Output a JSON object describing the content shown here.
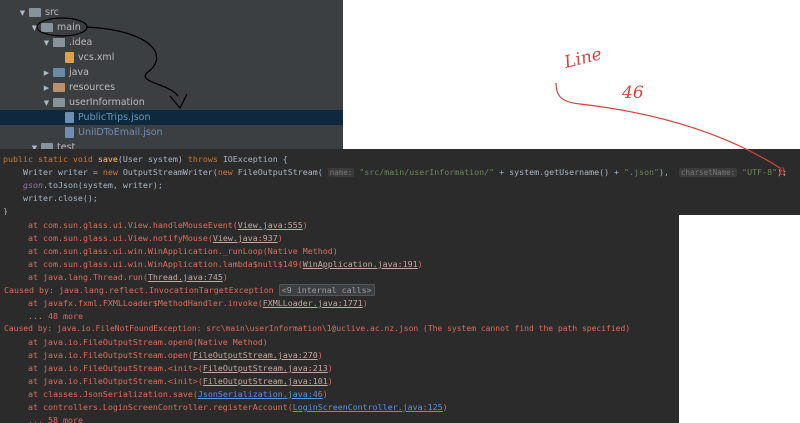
{
  "tree": [
    {
      "label": "src",
      "kind": "folder",
      "depth": 2,
      "expanded": true
    },
    {
      "label": "main",
      "kind": "folder",
      "depth": 3,
      "expanded": true
    },
    {
      "label": ".idea",
      "kind": "folder",
      "depth": 4,
      "expanded": true
    },
    {
      "label": "vcs.xml",
      "kind": "xml",
      "depth": 5
    },
    {
      "label": "java",
      "kind": "folder-blue",
      "depth": 4,
      "expanded": false
    },
    {
      "label": "resources",
      "kind": "folder-orange",
      "depth": 4,
      "expanded": false
    },
    {
      "label": "userInformation",
      "kind": "folder",
      "depth": 4,
      "expanded": true
    },
    {
      "label": "PublicTrips.json",
      "kind": "json",
      "depth": 5,
      "selected": true
    },
    {
      "label": "UniIDToEmail.json",
      "kind": "json",
      "depth": 5,
      "muted": true
    },
    {
      "label": "test",
      "kind": "folder",
      "depth": 3,
      "expanded": true
    }
  ],
  "code": {
    "l1_kw1": "public static void ",
    "l1_fn": "save",
    "l1_mid": "(User system) ",
    "l1_kw2": "throws ",
    "l1_end": "IOException {",
    "l2_a": "    Writer writer = ",
    "l2_kw": "new ",
    "l2_b": "OutputStreamWriter(",
    "l2_kw2": "new ",
    "l2_c": "FileOutputStream( ",
    "l2_hint1": "name:",
    "l2_str1": " \"src/main/userInformation/\"",
    "l2_d": " + system.getUsername() + ",
    "l2_str2": "\".json\"",
    "l2_e": "),  ",
    "l2_hint2": "charsetName:",
    "l2_str3": " \"UTF-8\"",
    "l2_f": ");",
    "l3_field": "    gson",
    "l3_rest": ".toJson(system, writer);",
    "l4": "    writer.close();",
    "l5": "}"
  },
  "console": {
    "r1_pre": "at com.sun.glass.ui.View.handleMouseEvent(",
    "r1_link": "View.java:555",
    "r1_post": ")",
    "r2_pre": "at com.sun.glass.ui.View.notifyMouse(",
    "r2_link": "View.java:937",
    "r2_post": ")",
    "r3": "at com.sun.glass.ui.win.WinApplication._runLoop(Native Method)",
    "r4_pre": "at com.sun.glass.ui.win.WinApplication.lambda$null$149(",
    "r4_link": "WinApplication.java:191",
    "r4_post": ")",
    "r5_pre": "at java.lang.Thread.run(",
    "r5_link": "Thread.java:745",
    "r5_post": ")",
    "r6_pre": "Caused by: java.lang.reflect.InvocationTargetException ",
    "r6_fold": "<9 internal calls>",
    "r7_pre": "at javafx.fxml.FXMLLoader$MethodHandler.invoke(",
    "r7_link": "FXMLLoader.java:1771",
    "r7_post": ")",
    "r8": "... 48 more",
    "r9": "Caused by: java.io.FileNotFoundException: src\\main\\userInformation\\1@uclive.ac.nz.json (The system cannot find the path specified)",
    "r10": "at java.io.FileOutputStream.open0(Native Method)",
    "r11_pre": "at java.io.FileOutputStream.open(",
    "r11_link": "FileOutputStream.java:270",
    "r11_post": ")",
    "r12_pre": "at java.io.FileOutputStream.<init>(",
    "r12_link": "FileOutputStream.java:213",
    "r12_post": ")",
    "r13_pre": "at java.io.FileOutputStream.<init>(",
    "r13_link": "FileOutputStream.java:101",
    "r13_post": ")",
    "r14_pre": "at classes.JsonSerialization.save(",
    "r14_link": "JsonSerialization.java:46",
    "r14_post": ")",
    "r15_pre": "at controllers.LoginScreenController.registerAccount(",
    "r15_link": "LoginScreenController.java:125",
    "r15_post": ")",
    "r16": "... 58 more"
  },
  "annotation": {
    "line1": "Line",
    "line2": "46",
    "color": "#d9413a"
  }
}
